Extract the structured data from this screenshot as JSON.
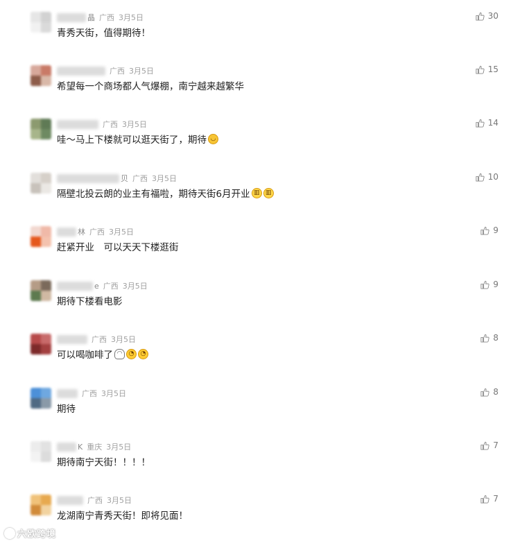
{
  "comments": [
    {
      "name_tail": "晶",
      "location": "广西",
      "date": "3月5日",
      "text": "青秀天街，值得期待！",
      "likes": "30",
      "avatar_colors": [
        "#e6e6e6",
        "#d2d2d2",
        "#f1f1f1",
        "#dadada"
      ],
      "emojis": []
    },
    {
      "name_tail": "",
      "location": "广西",
      "date": "3月5日",
      "text": "希望每一个商场都人气爆棚，南宁越来越繁华",
      "likes": "15",
      "avatar_colors": [
        "#d7a89b",
        "#c97a67",
        "#8e5c4a",
        "#d9b8a8"
      ],
      "emojis": []
    },
    {
      "name_tail": "",
      "location": "广西",
      "date": "3月5日",
      "text": "哇～马上下楼就可以逛天街了，期待",
      "likes": "14",
      "avatar_colors": [
        "#8c9a6f",
        "#5f7a55",
        "#a7b58a",
        "#6e8a62"
      ],
      "emojis": [
        "sleepy-face"
      ]
    },
    {
      "name_tail": "贝",
      "location": "广西",
      "date": "3月5日",
      "text": "隔壁北投云朗的业主有福啦，期待天街6月开业",
      "likes": "10",
      "avatar_colors": [
        "#e2dfdb",
        "#d6d0c9",
        "#c8c2bb",
        "#ebe8e4"
      ],
      "emojis": [
        "grinning-face",
        "grinning-face"
      ]
    },
    {
      "name_tail": "林",
      "location": "广西",
      "date": "3月5日",
      "text": "赶紧开业　可以天天下楼逛街",
      "likes": "9",
      "avatar_colors": [
        "#f2d8d0",
        "#f0b9a8",
        "#e5581d",
        "#f4c2ae"
      ],
      "emojis": []
    },
    {
      "name_tail": "e",
      "location": "广西",
      "date": "3月5日",
      "text": "期待下楼看电影",
      "likes": "9",
      "avatar_colors": [
        "#b59c86",
        "#7b6a5b",
        "#5d7a4f",
        "#d0b9a3"
      ],
      "emojis": []
    },
    {
      "name_tail": "",
      "location": "广西",
      "date": "3月5日",
      "text": "可以喝咖啡了",
      "likes": "8",
      "avatar_colors": [
        "#b74a4a",
        "#c86b6b",
        "#7d2a2a",
        "#a34040"
      ],
      "emojis": [
        "cloud-face",
        "thinking-face",
        "thinking-face"
      ]
    },
    {
      "name_tail": "",
      "location": "广西",
      "date": "3月5日",
      "text": "期待",
      "likes": "8",
      "avatar_colors": [
        "#4c90d8",
        "#6fa8e0",
        "#4f6a83",
        "#8a9aa8"
      ],
      "emojis": []
    },
    {
      "name_tail": "K",
      "location": "重庆",
      "date": "3月5日",
      "text": "期待南宁天街！！！！",
      "likes": "7",
      "avatar_colors": [
        "#ececec",
        "#e2e2e2",
        "#f3f3f3",
        "#dcdcdc"
      ],
      "emojis": []
    },
    {
      "name_tail": "",
      "location": "广西",
      "date": "3月5日",
      "text": "龙湖南宁青秀天街！即将见面！",
      "likes": "7",
      "avatar_colors": [
        "#f0c27a",
        "#e7a94f",
        "#d18b3a",
        "#f2d3a0"
      ],
      "emojis": []
    }
  ],
  "watermark": {
    "text": "六欧跨境"
  },
  "colors": {
    "text": "#222222",
    "meta": "#a0a0a0",
    "likes": "#777777"
  }
}
